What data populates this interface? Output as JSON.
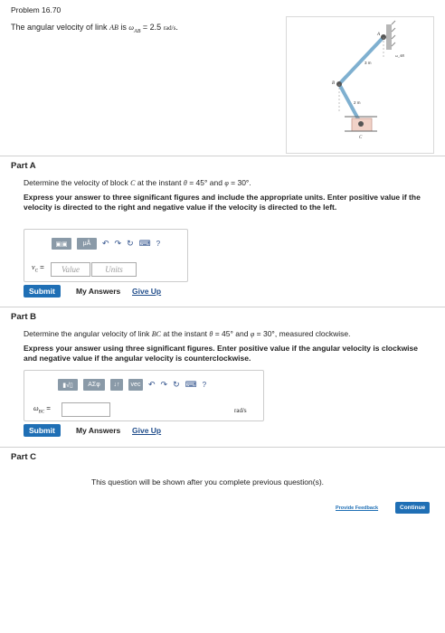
{
  "header": {
    "problem_title": "Problem 16.70",
    "intro_prefix": "The angular velocity of link",
    "intro_link": "AB",
    "intro_is": "is",
    "intro_symbol": "ω",
    "intro_sub": "AB",
    "intro_value": "= 2.5",
    "intro_unit": "rad/s",
    "intro_end": "."
  },
  "figure": {
    "label_A": "A",
    "label_B": "B",
    "label_C": "C",
    "label_len1": "3 m",
    "label_len2": "2 m",
    "label_omega": "ω_AB"
  },
  "part_a": {
    "title": "Part A",
    "question_prefix": "Determine the velocity of block",
    "question_var": "C",
    "question_mid": "at the instant",
    "theta": "θ",
    "theta_val": "= 45°",
    "and": "and",
    "phi": "φ",
    "phi_val": "= 30°.",
    "instructions": "Express your answer to three significant figures and include the appropriate units. Enter positive value if the velocity is directed to the right and negative value if the velocity is directed to the left.",
    "toolbar": {
      "btn1": "▣▣",
      "btn2": "μÅ",
      "help": "?"
    },
    "var_label": "v",
    "var_sub": "C",
    "eq": "=",
    "value_placeholder": "Value",
    "units_placeholder": "Units",
    "submit": "Submit",
    "my_answers": "My Answers",
    "give_up": "Give Up"
  },
  "part_b": {
    "title": "Part B",
    "question_prefix": "Determine the angular velocity of link",
    "question_var": "BC",
    "question_mid": "at the instant",
    "theta": "θ",
    "theta_val": "= 45°",
    "and": "and",
    "phi": "φ",
    "phi_val": "= 30°",
    "question_end": ", measured clockwise.",
    "instructions": "Express your answer using three significant figures. Enter positive value if the angular velocity is clockwise and negative value if the angular velocity is counterclockwise.",
    "toolbar": {
      "btn1": "▮√▯",
      "btn2": "ΑΣφ",
      "btn3": "↓↑",
      "btn4": "vec",
      "help": "?"
    },
    "var_label": "ω",
    "var_sub": "BC",
    "eq": "=",
    "unit": "rad/s",
    "submit": "Submit",
    "my_answers": "My Answers",
    "give_up": "Give Up"
  },
  "part_c": {
    "title": "Part C",
    "message": "This question will be shown after you complete previous question(s)."
  },
  "footer": {
    "provide_feedback": "Provide Feedback",
    "continue": "Continue"
  },
  "colors": {
    "accent": "#1f6fb5",
    "toolbar": "#8a9aa8"
  }
}
